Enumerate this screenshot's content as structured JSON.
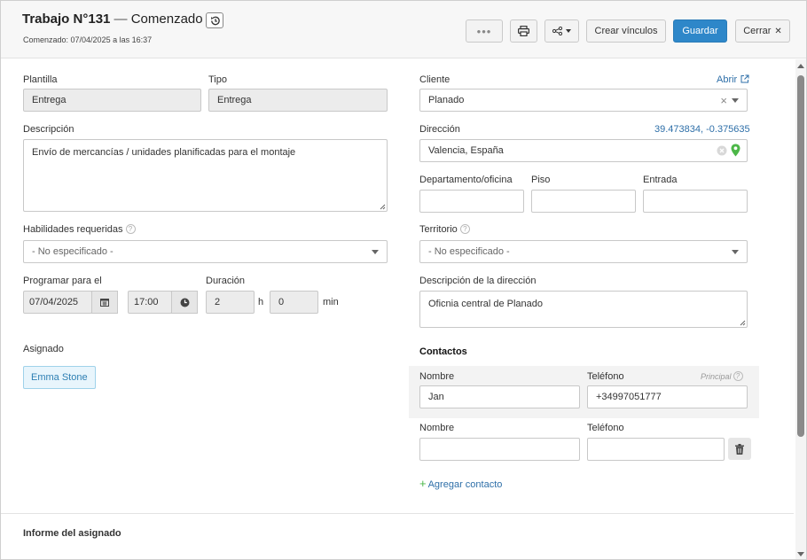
{
  "header": {
    "title_bold": "Trabajo N°131",
    "title_sep": " — ",
    "title_status": "Comenzado",
    "subtitle": "Comenzado: 07/04/2025 a las 16:37",
    "buttons": {
      "more": "•••",
      "crear_vinculos": "Crear vínculos",
      "guardar": "Guardar",
      "cerrar": "Cerrar",
      "cerrar_icon": "✕"
    }
  },
  "left": {
    "plantilla": {
      "label": "Plantilla",
      "value": "Entrega"
    },
    "tipo": {
      "label": "Tipo",
      "value": "Entrega"
    },
    "descripcion": {
      "label": "Descripción",
      "value": "Envío de mercancías / unidades planificadas para el montaje"
    },
    "habilidades": {
      "label": "Habilidades requeridas",
      "value": "- No especificado -"
    },
    "programar": {
      "label": "Programar para el",
      "date": "07/04/2025",
      "time": "17:00"
    },
    "duracion": {
      "label": "Duración",
      "hours": "2",
      "hours_unit": "h",
      "minutes": "0",
      "minutes_unit": "min"
    },
    "asignado": {
      "label": "Asignado",
      "value": "Emma Stone"
    },
    "informe": {
      "label": "Informe del asignado"
    }
  },
  "right": {
    "cliente": {
      "label": "Cliente",
      "open_link": "Abrir",
      "value": "Planado",
      "clear": "×"
    },
    "direccion": {
      "label": "Dirección",
      "coords": "39.473834, -0.375635",
      "value": "Valencia, España"
    },
    "departamento": {
      "label": "Departamento/oficina"
    },
    "piso": {
      "label": "Piso"
    },
    "entrada": {
      "label": "Entrada"
    },
    "territorio": {
      "label": "Territorio",
      "value": "- No especificado -"
    },
    "descripcion_direccion": {
      "label": "Descripción de la dirección",
      "value": "Oficnia central de Planado"
    },
    "contactos": {
      "heading": "Contactos",
      "principal_label": "Principal",
      "rows": [
        {
          "nombre_label": "Nombre",
          "telefono_label": "Teléfono",
          "nombre": "Jan",
          "telefono": "+34997051777"
        },
        {
          "nombre_label": "Nombre",
          "telefono_label": "Teléfono",
          "nombre": "",
          "telefono": ""
        }
      ],
      "add_link": "Agregar contacto",
      "add_icon": "+"
    }
  },
  "colors": {
    "primary": "#2e87c9",
    "link": "#2e6fa8",
    "pin": "#4cb748",
    "tag_bg": "#e8f5fc"
  }
}
